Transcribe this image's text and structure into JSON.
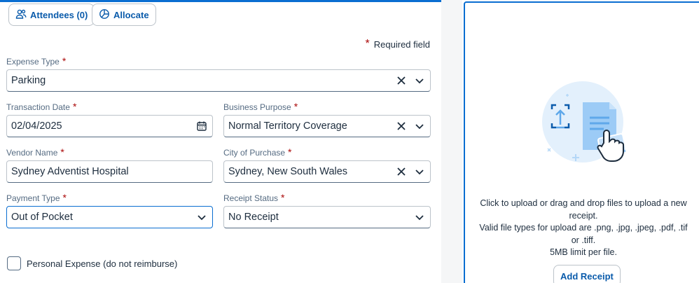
{
  "toolbar": {
    "attendees_label": "Attendees (0)",
    "allocate_label": "Allocate"
  },
  "required_note": "Required field",
  "fields": {
    "expense_type": {
      "label": "Expense Type",
      "value": "Parking"
    },
    "transaction_date": {
      "label": "Transaction Date",
      "value": "02/04/2025"
    },
    "business_purpose": {
      "label": "Business Purpose",
      "value": "Normal Territory Coverage"
    },
    "vendor_name": {
      "label": "Vendor Name",
      "value": "Sydney Adventist Hospital"
    },
    "city_of_purchase": {
      "label": "City of Purchase",
      "value": "Sydney, New South Wales"
    },
    "payment_type": {
      "label": "Payment Type",
      "value": "Out of Pocket"
    },
    "receipt_status": {
      "label": "Receipt Status",
      "value": "No Receipt"
    }
  },
  "personal_expense_label": "Personal Expense (do not reimburse)",
  "upload": {
    "line1": "Click to upload or drag and drop files to upload a new receipt.",
    "line2": "Valid file types for upload are .png, .jpg, .jpeg, .pdf, .tif or .tiff.",
    "line3": "5MB limit per file.",
    "add_button": "Add Receipt"
  },
  "colors": {
    "accent": "#0a6ed1",
    "link": "#0a5bab",
    "required": "#aa0808"
  }
}
